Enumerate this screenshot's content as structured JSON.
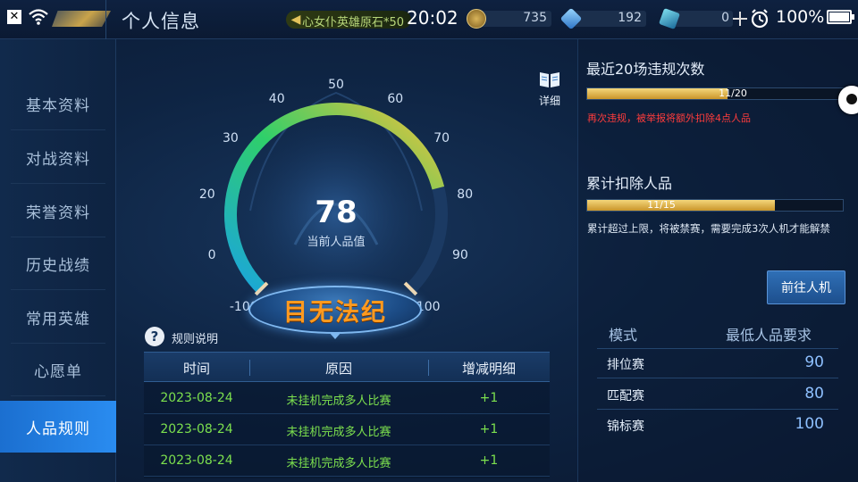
{
  "header": {
    "title": "个人信息",
    "marquee": "心女仆英雄原石*50",
    "clock": "20:02",
    "currencies": [
      {
        "icon": "gold-coin-icon",
        "value": "735"
      },
      {
        "icon": "diamond-icon",
        "value": "192"
      },
      {
        "icon": "crystal-icon",
        "value": "0"
      }
    ],
    "battery": "100%",
    "battery_level": 1.0
  },
  "sidebar": {
    "items": [
      {
        "label": "基本资料",
        "active": false
      },
      {
        "label": "对战资料",
        "active": false
      },
      {
        "label": "荣誉资料",
        "active": false
      },
      {
        "label": "历史战绩",
        "active": false
      },
      {
        "label": "常用英雄",
        "active": false
      },
      {
        "label": "心愿单",
        "active": false
      },
      {
        "label": "人品规则",
        "active": true
      }
    ]
  },
  "gauge": {
    "ticks": [
      "-100",
      "0",
      "20",
      "30",
      "40",
      "50",
      "60",
      "70",
      "80",
      "90",
      "100"
    ],
    "score": "78",
    "score_value": 78,
    "score_label": "当前人品值",
    "verdict": "目无法纪",
    "detail_label": "详细"
  },
  "rules": {
    "title": "规则说明",
    "columns": [
      "时间",
      "原因",
      "增减明细"
    ],
    "rows": [
      {
        "time": "2023-08-24",
        "reason": "未挂机完成多人比赛",
        "delta": "+1"
      },
      {
        "time": "2023-08-24",
        "reason": "未挂机完成多人比赛",
        "delta": "+1"
      },
      {
        "time": "2023-08-24",
        "reason": "未挂机完成多人比赛",
        "delta": "+1"
      }
    ]
  },
  "violations": {
    "title": "最近20场违规次数",
    "progress_label": "11/20",
    "progress": 0.55,
    "warning": "再次违规，被举报将额外扣除4点人品"
  },
  "deduction": {
    "title": "累计扣除人品",
    "progress_label": "11/15",
    "progress": 0.733,
    "note": "累计超过上限，将被禁赛，需要完成3次人机才能解禁"
  },
  "goto_button": "前往人机",
  "modes": {
    "headers": [
      "模式",
      "最低人品要求"
    ],
    "rows": [
      {
        "name": "排位赛",
        "min": "90"
      },
      {
        "name": "匹配赛",
        "min": "80"
      },
      {
        "name": "锦标赛",
        "min": "100"
      }
    ]
  },
  "colors": {
    "active_tab": "#2a8cf0",
    "positive_text": "#7ce04e",
    "warning_text": "#ff3c3c",
    "verdict_text": "#ff9a1f",
    "gauge_low": "#1aa4e0",
    "gauge_mid": "#2fcf6a",
    "gauge_high": "#f0c23a"
  }
}
